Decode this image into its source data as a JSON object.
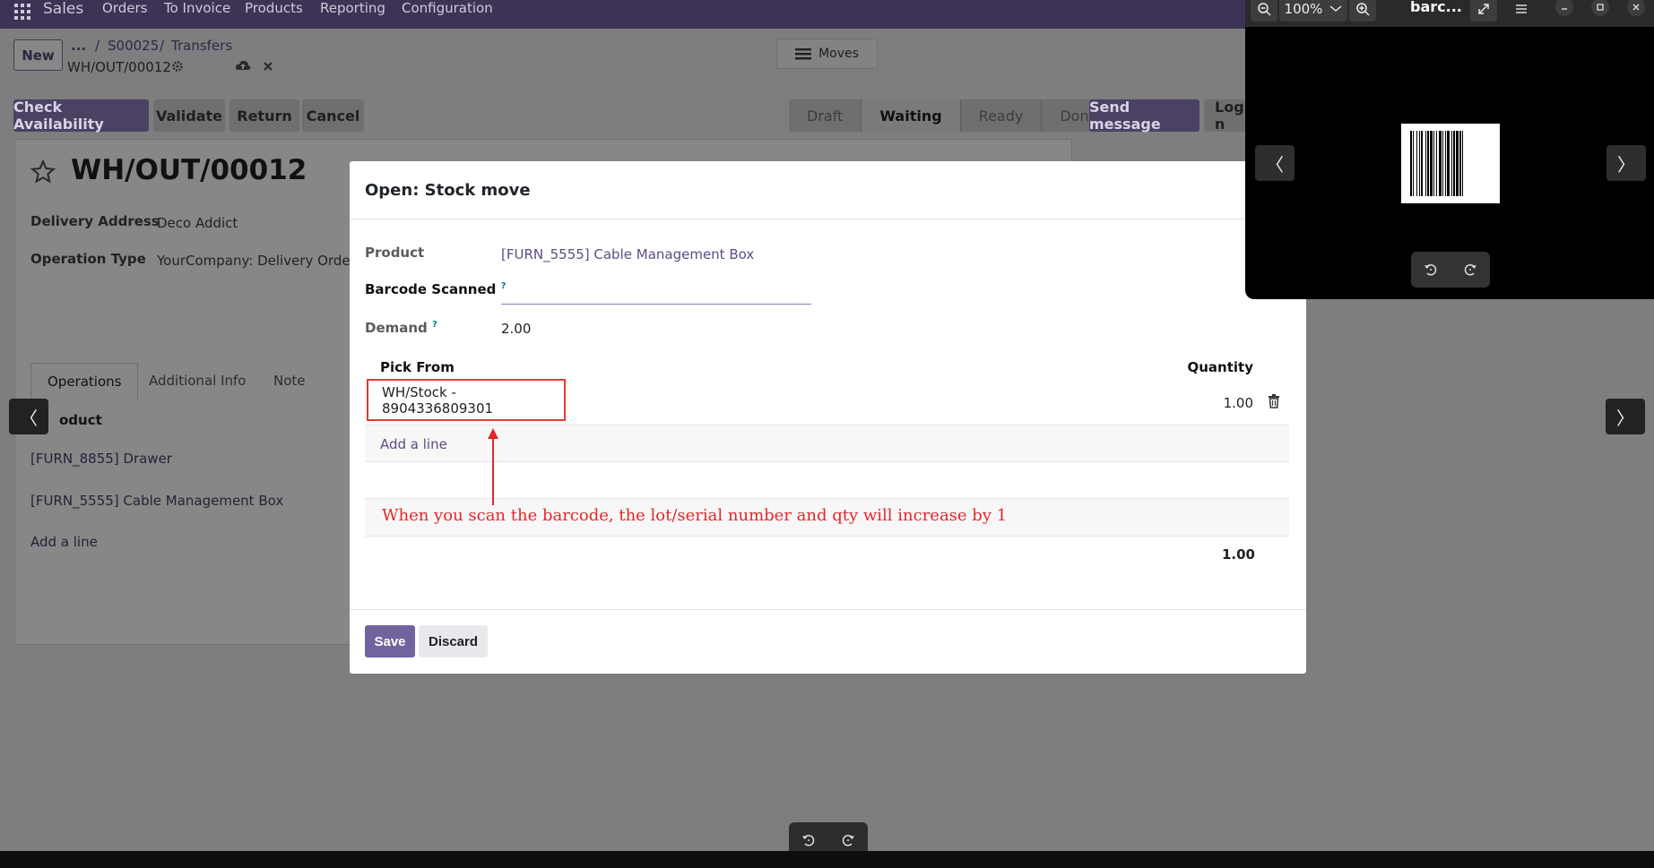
{
  "topnav": {
    "app_name": "Sales",
    "menu": [
      "Orders",
      "To Invoice",
      "Products",
      "Reporting",
      "Configuration"
    ]
  },
  "control_panel": {
    "new_label": "New",
    "breadcrumb_more": "...",
    "breadcrumb_order": "S00025",
    "breadcrumb_sep": "/",
    "breadcrumb_transfers": "Transfers",
    "record_ref": "WH/OUT/00012",
    "moves_label": "Moves"
  },
  "actions": {
    "check_availability": "Check Availability",
    "validate": "Validate",
    "return": "Return",
    "cancel": "Cancel",
    "send_message": "Send message",
    "log_note": "Log n"
  },
  "status_steps": [
    "Draft",
    "Waiting",
    "Ready",
    "Done"
  ],
  "status_active": "Waiting",
  "record": {
    "title": "WH/OUT/00012",
    "delivery_address_label": "Delivery Address",
    "delivery_address_value": "Deco Addict",
    "operation_type_label": "Operation Type",
    "operation_type_value": "YourCompany: Delivery Orders",
    "tabs": [
      "Operations",
      "Additional Info",
      "Note"
    ],
    "product_header": "oduct",
    "lines": [
      "[FURN_8855] Drawer",
      "[FURN_5555] Cable Management Box"
    ],
    "add_line": "Add a line"
  },
  "modal": {
    "title": "Open: Stock move",
    "product_label": "Product",
    "product_value": "[FURN_5555] Cable Management Box",
    "barcode_label": "Barcode Scanned",
    "barcode_value": "",
    "demand_label": "Demand",
    "demand_value": "2.00",
    "help_mark": "?",
    "col_pick_from": "Pick From",
    "col_quantity": "Quantity",
    "row_location": "WH/Stock - 8904336809301",
    "row_quantity": "1.00",
    "add_line": "Add a line",
    "annotation": "When you scan the barcode, the lot/serial number and qty will increase by 1",
    "total": "1.00",
    "save": "Save",
    "discard": "Discard"
  },
  "viewer": {
    "zoom": "100%",
    "title": "barc...",
    "prev": "〈",
    "next": "〉"
  },
  "colors": {
    "primary": "#71639e",
    "annotation_red": "#e3262b",
    "link": "#5d4b86"
  }
}
